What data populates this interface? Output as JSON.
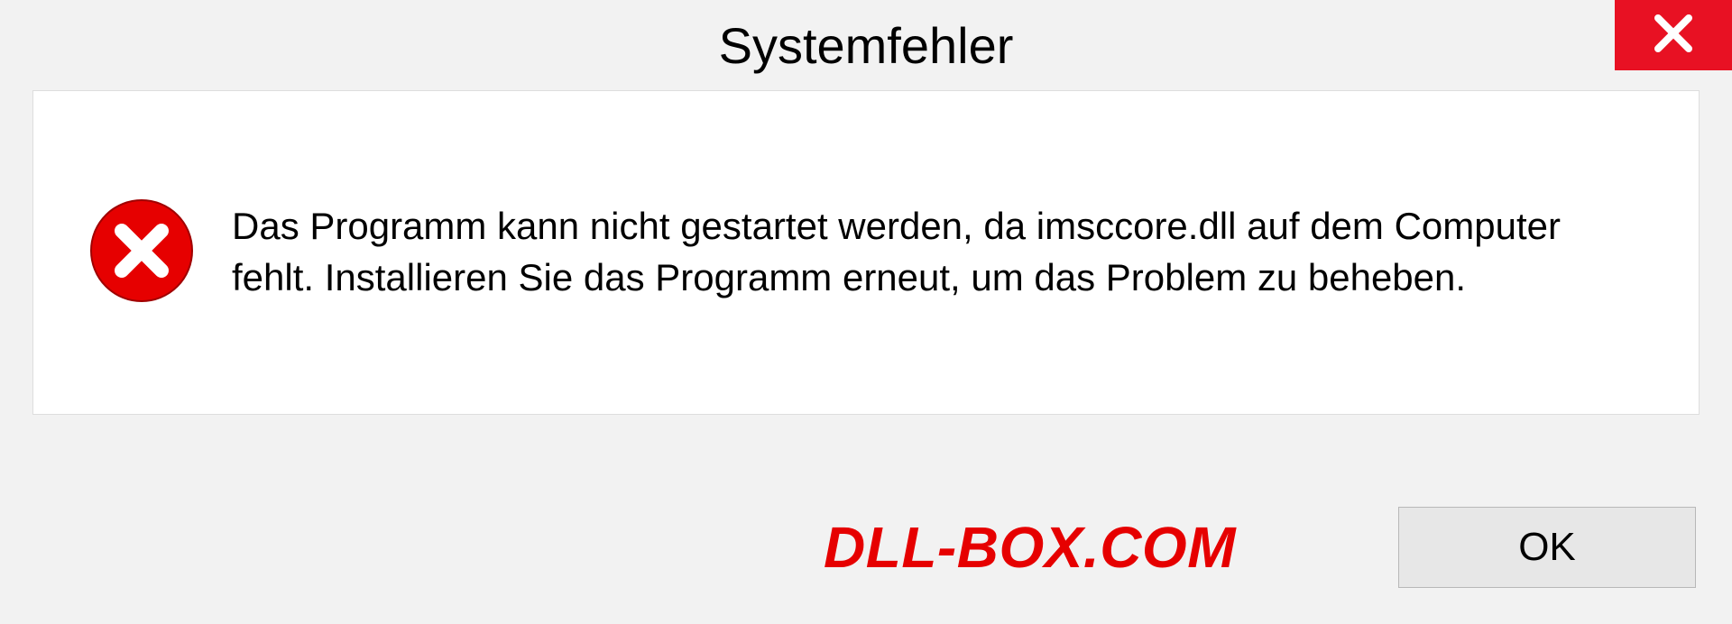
{
  "dialog": {
    "title": "Systemfehler",
    "message": "Das Programm kann nicht gestartet werden, da imsccore.dll auf dem Computer fehlt. Installieren Sie das Programm erneut, um das Problem zu beheben.",
    "ok_label": "OK"
  },
  "watermark": {
    "text": "DLL-BOX.COM"
  }
}
